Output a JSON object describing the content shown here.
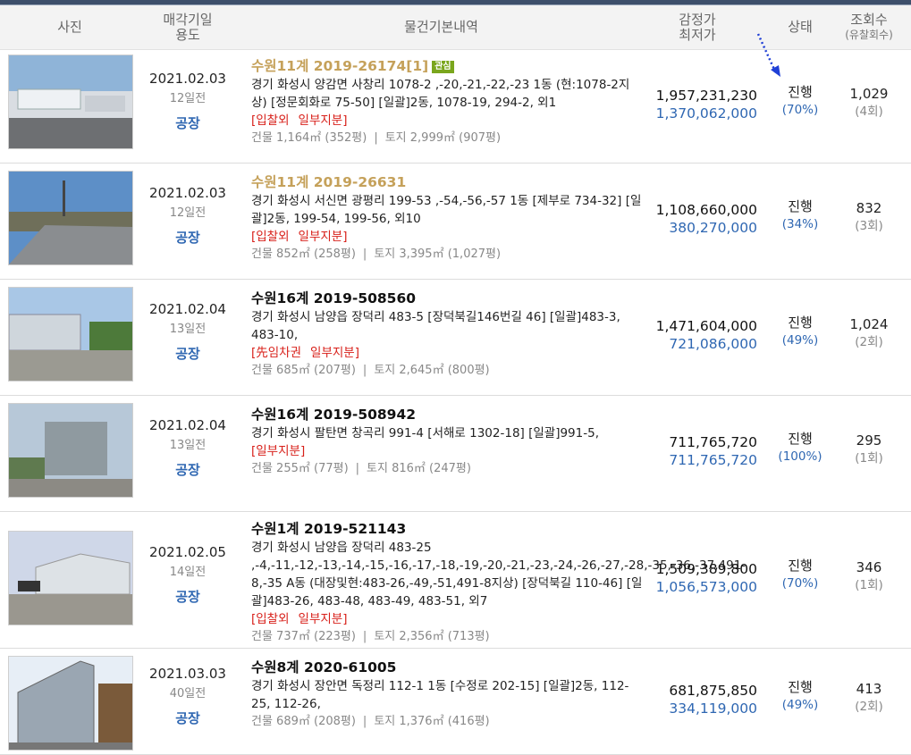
{
  "header": {
    "photo": "사진",
    "sale_date": "매각기일",
    "use": "용도",
    "details": "물건기본내역",
    "appraisal": "감정가",
    "min_price": "최저가",
    "status": "상태",
    "views": "조회수",
    "fail_count": "(유찰회수)"
  },
  "rows": [
    {
      "date": "2021.02.03",
      "days_left": "12일전",
      "use": "공장",
      "case": "수원11계 2019-26174[1]",
      "case_highlight": true,
      "badge": "관심",
      "address": "경기 화성시 양감면 사창리 1078-2 ,-20,-21,-22,-23 1동 (현:1078-2지상) [정문회화로 75-50] [일괄]2동, 1078-19, 294-2, 외1",
      "tags": [
        "[입찰외",
        "일부지분]"
      ],
      "building": "건물 1,164㎡ (352평)",
      "land": "토지 2,999㎡ (907평)",
      "appraisal": "1,957,231,230",
      "min_price": "1,370,062,000",
      "status": "진행",
      "percent": "(70%)",
      "views": "1,029",
      "fail_count": "(4회)"
    },
    {
      "date": "2021.02.03",
      "days_left": "12일전",
      "use": "공장",
      "case": "수원11계 2019-26631",
      "case_highlight": true,
      "badge": "",
      "address": "경기 화성시 서신면 광평리 199-53 ,-54,-56,-57 1동 [제부로 734-32] [일괄]2동, 199-54, 199-56, 외10",
      "tags": [
        "[입찰외",
        "일부지분]"
      ],
      "building": "건물 852㎡ (258평)",
      "land": "토지 3,395㎡ (1,027평)",
      "appraisal": "1,108,660,000",
      "min_price": "380,270,000",
      "status": "진행",
      "percent": "(34%)",
      "views": "832",
      "fail_count": "(3회)"
    },
    {
      "date": "2021.02.04",
      "days_left": "13일전",
      "use": "공장",
      "case": "수원16계 2019-508560",
      "case_highlight": false,
      "badge": "",
      "address": "경기 화성시 남양읍 장덕리 483-5 [장덕북길146번길 46] [일괄]483-3, 483-10,",
      "tags": [
        "[先임차권",
        "일부지분]"
      ],
      "building": "건물 685㎡ (207평)",
      "land": "토지 2,645㎡ (800평)",
      "appraisal": "1,471,604,000",
      "min_price": "721,086,000",
      "status": "진행",
      "percent": "(49%)",
      "views": "1,024",
      "fail_count": "(2회)"
    },
    {
      "date": "2021.02.04",
      "days_left": "13일전",
      "use": "공장",
      "case": "수원16계 2019-508942",
      "case_highlight": false,
      "badge": "",
      "address": "경기 화성시 팔탄면 창곡리 991-4 [서해로 1302-18] [일괄]991-5,",
      "tags": [
        "[일부지분]"
      ],
      "building": "건물 255㎡ (77평)",
      "land": "토지 816㎡ (247평)",
      "appraisal": "711,765,720",
      "min_price": "711,765,720",
      "status": "진행",
      "percent": "(100%)",
      "views": "295",
      "fail_count": "(1회)"
    },
    {
      "date": "2021.02.05",
      "days_left": "14일전",
      "use": "공장",
      "case": "수원1계 2019-521143",
      "case_highlight": false,
      "badge": "",
      "address": "경기 화성시 남양읍 장덕리 483-25 ,-4,-11,-12,-13,-14,-15,-16,-17,-18,-19,-20,-21,-23,-24,-26,-27,-28,-35,-36,-37,491-8,-35 A동 (대장및현:483-26,-49,-51,491-8지상) [장덕북길 110-46] [일괄]483-26, 483-48, 483-49, 483-51, 외7",
      "tags": [
        "[입찰외",
        "일부지분]"
      ],
      "building": "건물 737㎡ (223평)",
      "land": "토지 2,356㎡ (713평)",
      "appraisal": "1,509,389,800",
      "min_price": "1,056,573,000",
      "status": "진행",
      "percent": "(70%)",
      "views": "346",
      "fail_count": "(1회)"
    },
    {
      "date": "2021.03.03",
      "days_left": "40일전",
      "use": "공장",
      "case": "수원8계 2020-61005",
      "case_highlight": false,
      "badge": "",
      "address": "경기 화성시 장안면 독정리 112-1 1동 [수정로 202-15] [일괄]2동, 112-25, 112-26,",
      "tags": [],
      "building": "건물 689㎡ (208평)",
      "land": "토지 1,376㎡ (416평)",
      "appraisal": "681,875,850",
      "min_price": "334,119,000",
      "status": "진행",
      "percent": "(49%)",
      "views": "413",
      "fail_count": "(2회)"
    }
  ],
  "colors": {
    "accent_blue": "#2f67b2",
    "case_gold": "#c5a15a",
    "tag_red": "#d8201a",
    "badge_green": "#7aa61d"
  },
  "icons": {
    "annotation": "dotted-arrow-icon"
  }
}
